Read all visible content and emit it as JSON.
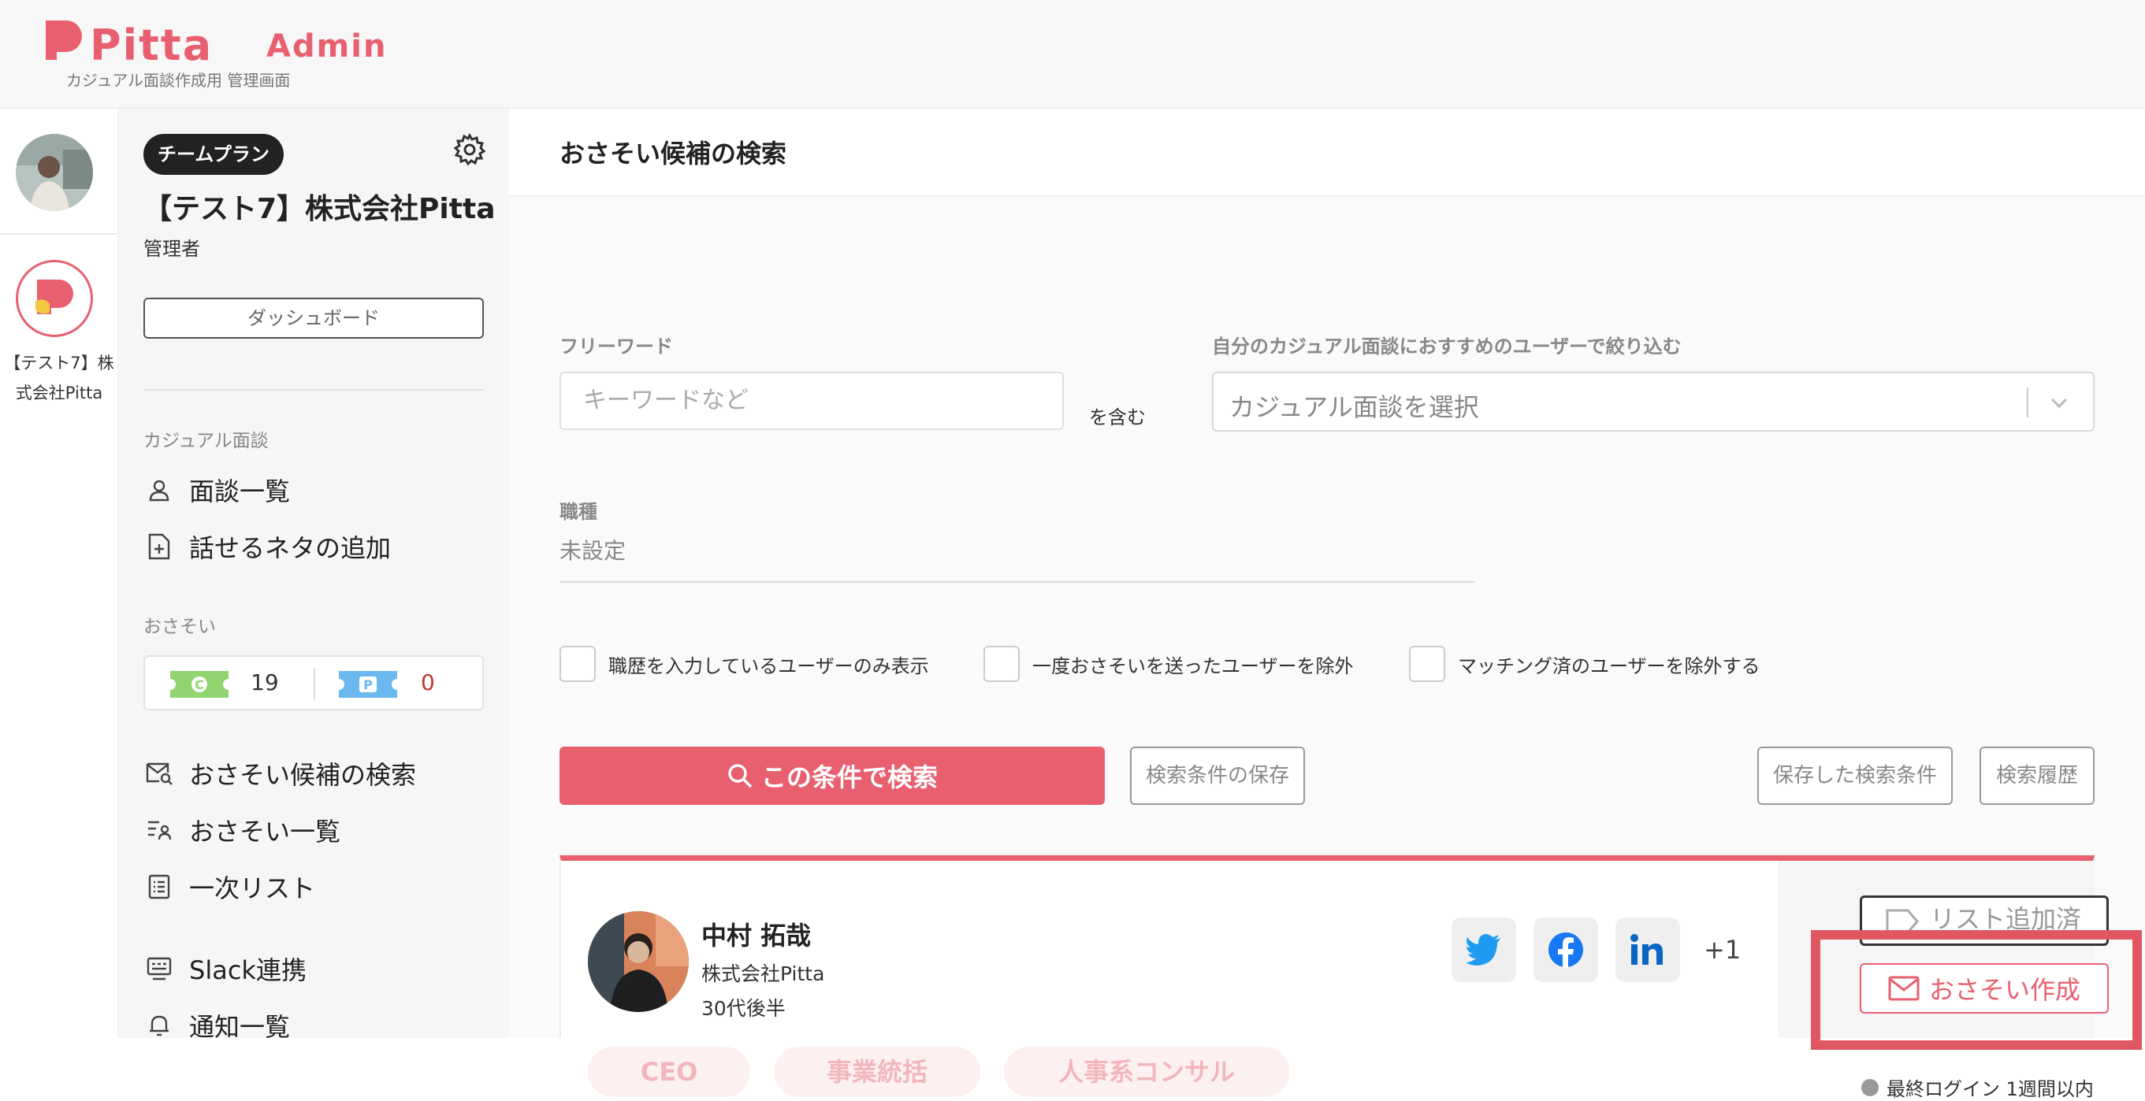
{
  "header": {
    "logo_text": "Pitta",
    "logo_admin": "Admin",
    "subtitle": "カジュアル面談作成用 管理画面"
  },
  "rail": {
    "company_name": "【テスト7】株式会社Pitta"
  },
  "sidebar": {
    "plan_badge": "チームプラン",
    "company": "【テスト7】株式会社Pitta",
    "role": "管理者",
    "dashboard_button": "ダッシュボード",
    "section_casual": "カジュアル面談",
    "casual_items": [
      {
        "label": "面談一覧",
        "icon": "person-icon"
      },
      {
        "label": "話せるネタの追加",
        "icon": "add-document-icon"
      }
    ],
    "section_invite": "おさそい",
    "tickets": {
      "c_count": "19",
      "p_count": "0",
      "c_color": "#8fd46e",
      "p_color": "#6bb8f0"
    },
    "invite_items": [
      {
        "label": "おさそい候補の検索",
        "icon": "mail-search-icon"
      },
      {
        "label": "おさそい一覧",
        "icon": "list-people-icon"
      },
      {
        "label": "一次リスト",
        "icon": "checklist-icon"
      }
    ],
    "other_items": [
      {
        "label": "Slack連携",
        "icon": "slack-board-icon"
      },
      {
        "label": "通知一覧",
        "icon": "bell-icon"
      }
    ]
  },
  "main": {
    "title": "おさそい候補の検索",
    "freeword_label": "フリーワード",
    "freeword_placeholder": "キーワードなど",
    "contains_label": "を含む",
    "recommend_label": "自分のカジュアル面談におすすめのユーザーで絞り込む",
    "recommend_placeholder": "カジュアル面談を選択",
    "job_label": "職種",
    "job_value": "未設定",
    "checkboxes": [
      "職歴を入力しているユーザーのみ表示",
      "一度おさそいを送ったユーザーを除外",
      "マッチング済のユーザーを除外する"
    ],
    "search_button": "この条件で検索",
    "save_condition_button": "検索条件の保存",
    "saved_conditions_button": "保存した検索条件",
    "history_button": "検索履歴"
  },
  "result": {
    "name": "中村 拓哉",
    "company": "株式会社Pitta",
    "age": "30代後半",
    "tags": [
      "CEO",
      "事業統括",
      "人事系コンサル"
    ],
    "social_more": "+1",
    "list_button": "リスト追加済",
    "invite_button": "おさそい作成",
    "last_login": "最終ログイン 1週間以内"
  },
  "colors": {
    "accent": "#e8606f",
    "highlight": "#e05762"
  }
}
